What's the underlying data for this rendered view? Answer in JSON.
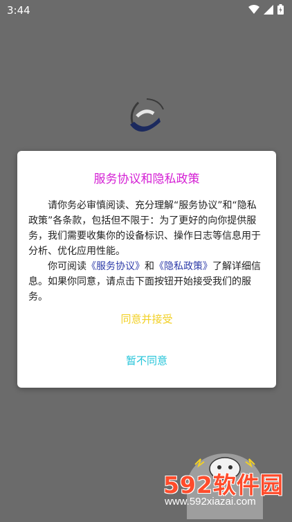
{
  "status_bar": {
    "time": "3:44",
    "icons": [
      "wifi-icon",
      "signal-icon",
      "battery-icon"
    ]
  },
  "dialog": {
    "title": "服务协议和隐私政策",
    "paragraph1": "请你务必审慎阅读、充分理解“服务协议”和“隐私政策”各条款，包括但不限于：为了更好的向你提供服务，我们需要收集你的设备标识、操作日志等信息用于分析、优化应用性能。",
    "paragraph2_prefix": "你可阅读",
    "service_link": "《服务协议》",
    "and_text": "和",
    "privacy_link": "《隐私政策》",
    "paragraph2_suffix": "了解详细信息。如果你同意，请点击下面按钮开始接受我们的服务。",
    "agree_label": "同意并接受",
    "disagree_label": "暂不同意"
  },
  "watermark": {
    "brand": "592软件园",
    "url": "www.592xiazai.com"
  },
  "colors": {
    "title": "#d41fd4",
    "link": "#2d3ba8",
    "agree": "#f2d024",
    "disagree": "#23c4d9",
    "background": "#6b6b6b"
  }
}
